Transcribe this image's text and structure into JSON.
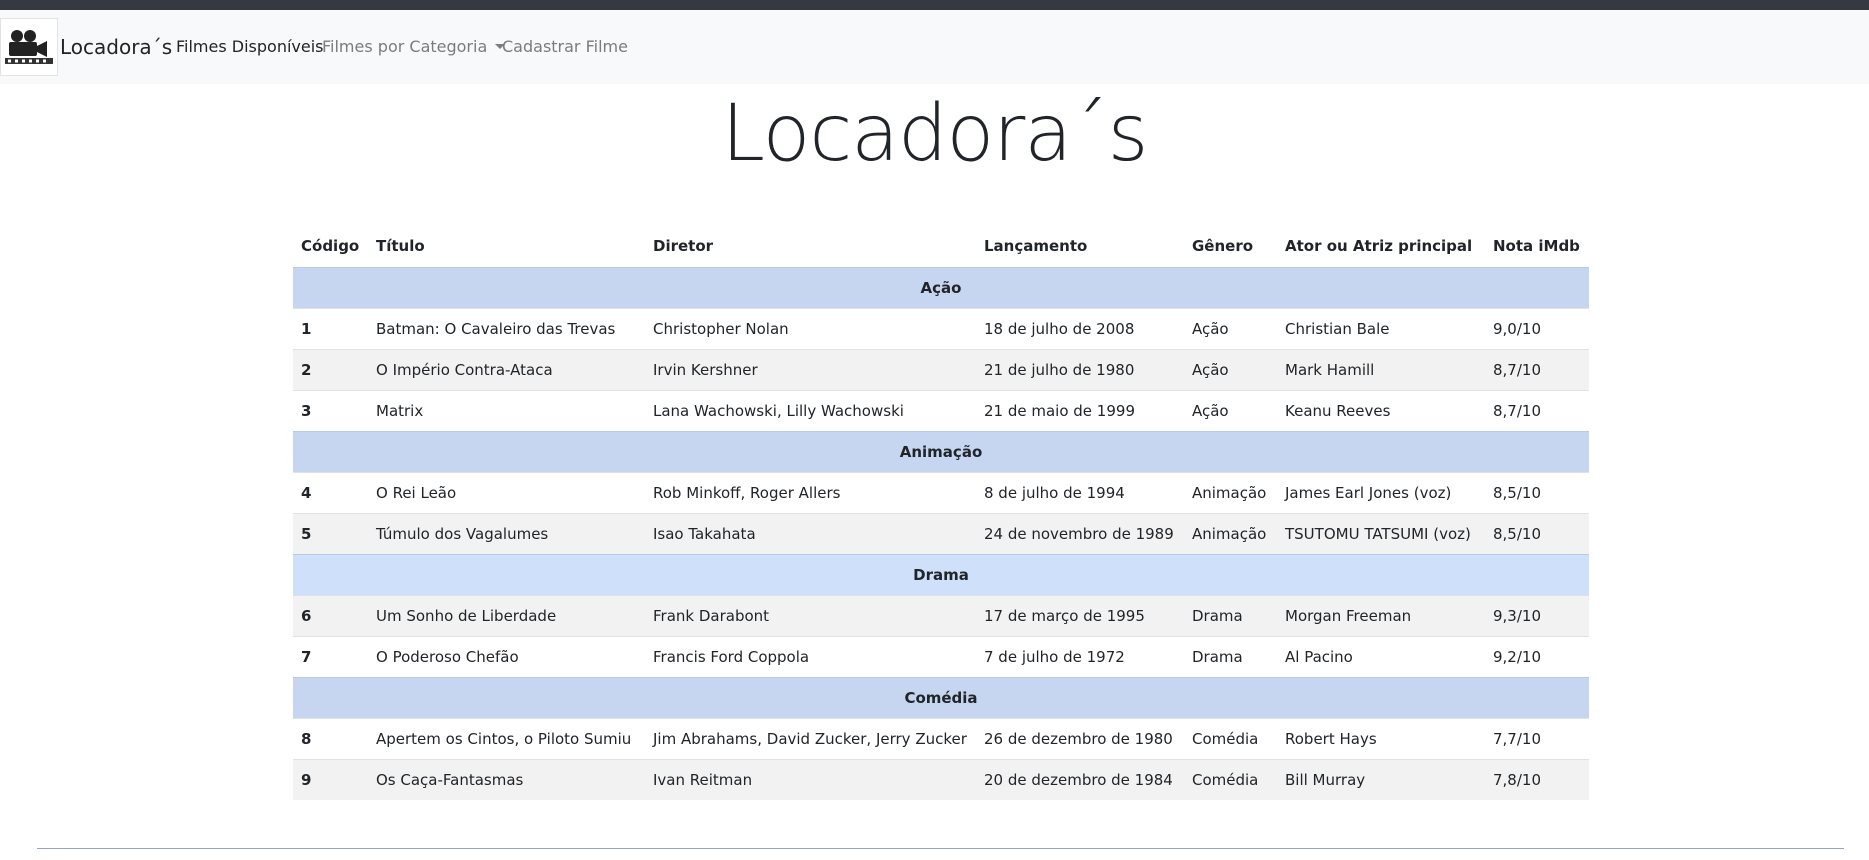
{
  "navbar": {
    "brand": "Locadora´s",
    "logo_icon": "film-camera-icon",
    "links": {
      "disponiveis": "Filmes Disponíveis",
      "categoria": "Filmes por Categoria",
      "cadastrar": "Cadastrar Filme"
    }
  },
  "page_title": "Locadora´s",
  "table": {
    "headers": {
      "codigo": "Código",
      "titulo": "Título",
      "diretor": "Diretor",
      "lancamento": "Lançamento",
      "genero": "Gênero",
      "ator": "Ator ou Atriz principal",
      "nota": "Nota iMdb"
    },
    "categories": {
      "acao": "Ação",
      "animacao": "Animação",
      "drama": "Drama",
      "comedia": "Comédia"
    },
    "rows": [
      {
        "codigo": "1",
        "titulo": "Batman: O Cavaleiro das Trevas",
        "diretor": "Christopher Nolan",
        "lancamento": "18 de julho de 2008",
        "genero": "Ação",
        "ator": "Christian Bale",
        "nota": "9,0/10"
      },
      {
        "codigo": "2",
        "titulo": "O Império Contra-Ataca",
        "diretor": "Irvin Kershner",
        "lancamento": "21 de julho de 1980",
        "genero": "Ação",
        "ator": "Mark Hamill",
        "nota": "8,7/10"
      },
      {
        "codigo": "3",
        "titulo": "Matrix",
        "diretor": "Lana Wachowski, Lilly Wachowski",
        "lancamento": "21 de maio de 1999",
        "genero": "Ação",
        "ator": "Keanu Reeves",
        "nota": "8,7/10"
      },
      {
        "codigo": "4",
        "titulo": "O Rei Leão",
        "diretor": "Rob Minkoff, Roger Allers",
        "lancamento": "8 de julho de 1994",
        "genero": "Animação",
        "ator": "James Earl Jones (voz)",
        "nota": "8,5/10"
      },
      {
        "codigo": "5",
        "titulo": "Túmulo dos Vagalumes",
        "diretor": "Isao Takahata",
        "lancamento": "24 de novembro de 1989",
        "genero": "Animação",
        "ator": "TSUTOMU TATSUMI (voz)",
        "nota": "8,5/10"
      },
      {
        "codigo": "6",
        "titulo": "Um Sonho de Liberdade",
        "diretor": "Frank Darabont",
        "lancamento": "17 de março de 1995",
        "genero": "Drama",
        "ator": "Morgan Freeman",
        "nota": "9,3/10"
      },
      {
        "codigo": "7",
        "titulo": "O Poderoso Chefão",
        "diretor": "Francis Ford Coppola",
        "lancamento": "7 de julho de 1972",
        "genero": "Drama",
        "ator": "Al Pacino",
        "nota": "9,2/10"
      },
      {
        "codigo": "8",
        "titulo": "Apertem os Cintos, o Piloto Sumiu",
        "diretor": "Jim Abrahams, David Zucker, Jerry Zucker",
        "lancamento": "26 de dezembro de 1980",
        "genero": "Comédia",
        "ator": "Robert Hays",
        "nota": "7,7/10"
      },
      {
        "codigo": "9",
        "titulo": "Os Caça-Fantasmas",
        "diretor": "Ivan Reitman",
        "lancamento": "20 de dezembro de 1984",
        "genero": "Comédia",
        "ator": "Bill Murray",
        "nota": "7,8/10"
      }
    ]
  },
  "colors": {
    "navbar_bg": "#f8f9fa",
    "topbar": "#343a40",
    "category_row": "#c6d6f1",
    "striped_row": "#f2f2f2"
  }
}
